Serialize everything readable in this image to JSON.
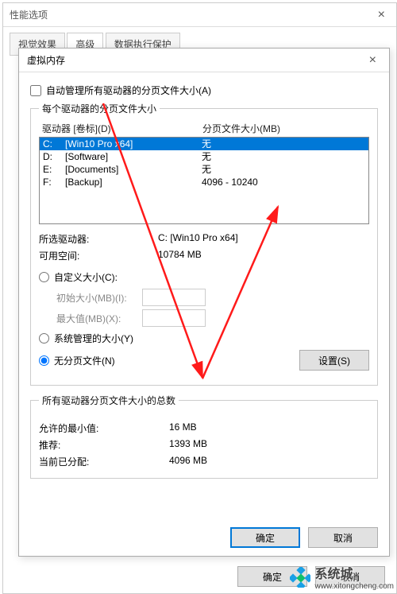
{
  "outer": {
    "title": "性能选项",
    "tabs": [
      "视觉效果",
      "高级",
      "数据执行保护"
    ],
    "ok": "确定",
    "cancel": "取消"
  },
  "dialog": {
    "title": "虚拟内存",
    "auto_manage": "自动管理所有驱动器的分页文件大小(A)",
    "group1_title": "每个驱动器的分页文件大小",
    "col_drive": "驱动器 [卷标](D)",
    "col_size": "分页文件大小(MB)",
    "rows": [
      {
        "drive": "C:",
        "vol": "[Win10 Pro x64]",
        "size": "无"
      },
      {
        "drive": "D:",
        "vol": "[Software]",
        "size": "无"
      },
      {
        "drive": "E:",
        "vol": "[Documents]",
        "size": "无"
      },
      {
        "drive": "F:",
        "vol": "[Backup]",
        "size": "4096 - 10240"
      }
    ],
    "sel_drive_label": "所选驱动器:",
    "sel_drive_value": "C:  [Win10 Pro x64]",
    "free_label": "可用空间:",
    "free_value": "10784 MB",
    "opt_custom": "自定义大小(C):",
    "init_label": "初始大小(MB)(I):",
    "max_label": "最大值(MB)(X):",
    "opt_system": "系统管理的大小(Y)",
    "opt_none": "无分页文件(N)",
    "set_btn": "设置(S)",
    "group2_title": "所有驱动器分页文件大小的总数",
    "min_label": "允许的最小值:",
    "min_value": "16 MB",
    "rec_label": "推荐:",
    "rec_value": "1393 MB",
    "cur_label": "当前已分配:",
    "cur_value": "4096 MB",
    "ok": "确定",
    "cancel": "取消"
  },
  "watermark": {
    "text": "系统城",
    "url": "www.xitongcheng.com"
  }
}
